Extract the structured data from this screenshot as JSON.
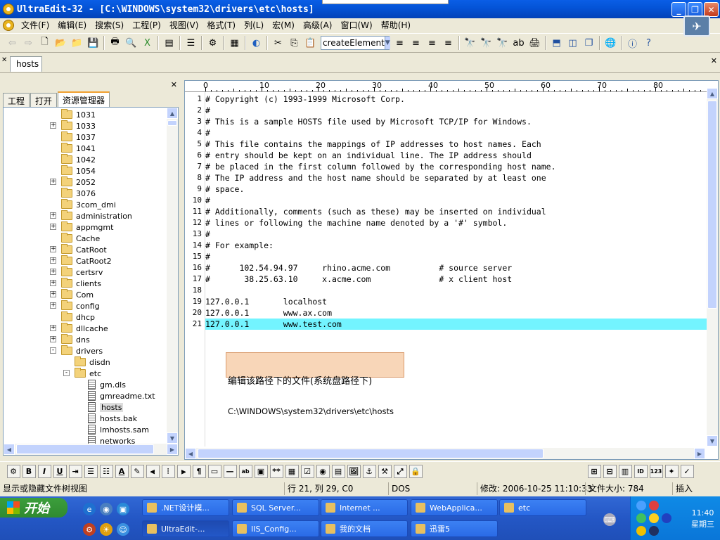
{
  "window": {
    "title": "UltraEdit-32 - [C:\\WINDOWS\\system32\\drivers\\etc\\hosts]"
  },
  "menu": [
    "文件(F)",
    "编辑(E)",
    "搜索(S)",
    "工程(P)",
    "视图(V)",
    "格式(T)",
    "列(L)",
    "宏(M)",
    "高级(A)",
    "窗口(W)",
    "帮助(H)"
  ],
  "toolbar": {
    "function_combo": "createElement"
  },
  "file_tab": {
    "label": "hosts"
  },
  "left_pane": {
    "tabs": [
      "工程",
      "打开",
      "资源管理器"
    ],
    "active_tab": "资源管理器",
    "tree": [
      {
        "label": "1031",
        "type": "folder",
        "expand": ""
      },
      {
        "label": "1033",
        "type": "folder",
        "expand": "+"
      },
      {
        "label": "1037",
        "type": "folder",
        "expand": ""
      },
      {
        "label": "1041",
        "type": "folder",
        "expand": ""
      },
      {
        "label": "1042",
        "type": "folder",
        "expand": ""
      },
      {
        "label": "1054",
        "type": "folder",
        "expand": ""
      },
      {
        "label": "2052",
        "type": "folder",
        "expand": "+"
      },
      {
        "label": "3076",
        "type": "folder",
        "expand": ""
      },
      {
        "label": "3com_dmi",
        "type": "folder",
        "expand": ""
      },
      {
        "label": "administration",
        "type": "folder",
        "expand": "+"
      },
      {
        "label": "appmgmt",
        "type": "folder",
        "expand": "+"
      },
      {
        "label": "Cache",
        "type": "folder",
        "expand": ""
      },
      {
        "label": "CatRoot",
        "type": "folder",
        "expand": "+"
      },
      {
        "label": "CatRoot2",
        "type": "folder",
        "expand": "+"
      },
      {
        "label": "certsrv",
        "type": "folder",
        "expand": "+"
      },
      {
        "label": "clients",
        "type": "folder",
        "expand": "+"
      },
      {
        "label": "Com",
        "type": "folder",
        "expand": "+"
      },
      {
        "label": "config",
        "type": "folder",
        "expand": "+"
      },
      {
        "label": "dhcp",
        "type": "folder",
        "expand": ""
      },
      {
        "label": "dllcache",
        "type": "folder",
        "expand": "+"
      },
      {
        "label": "dns",
        "type": "folder",
        "expand": "+"
      },
      {
        "label": "drivers",
        "type": "folder",
        "expand": "-"
      },
      {
        "label": "disdn",
        "type": "folder",
        "expand": "",
        "level": 1
      },
      {
        "label": "etc",
        "type": "folder",
        "expand": "-",
        "level": 1
      },
      {
        "label": "gm.dls",
        "type": "file",
        "level": 2
      },
      {
        "label": "gmreadme.txt",
        "type": "file",
        "level": 2
      },
      {
        "label": "hosts",
        "type": "file",
        "level": 2,
        "selected": true
      },
      {
        "label": "hosts.bak",
        "type": "file",
        "level": 2
      },
      {
        "label": "lmhosts.sam",
        "type": "file",
        "level": 2
      },
      {
        "label": "networks",
        "type": "file",
        "level": 2
      }
    ]
  },
  "ruler": {
    "labels": [
      "0",
      "10",
      "20",
      "30",
      "40",
      "50",
      "60",
      "70",
      "80"
    ]
  },
  "editor": {
    "lines": [
      "# Copyright (c) 1993-1999 Microsoft Corp.",
      "#",
      "# This is a sample HOSTS file used by Microsoft TCP/IP for Windows.",
      "#",
      "# This file contains the mappings of IP addresses to host names. Each",
      "# entry should be kept on an individual line. The IP address should",
      "# be placed in the first column followed by the corresponding host name.",
      "# The IP address and the host name should be separated by at least one",
      "# space.",
      "#",
      "# Additionally, comments (such as these) may be inserted on individual",
      "# lines or following the machine name denoted by a '#' symbol.",
      "#",
      "# For example:",
      "#",
      "#      102.54.94.97     rhino.acme.com          # source server",
      "#       38.25.63.10     x.acme.com              # x client host",
      "",
      "127.0.0.1       localhost",
      "127.0.0.1       www.ax.com",
      "127.0.0.1       www.test.com"
    ],
    "highlight_line": 21,
    "highlight_color": "#73f4ff"
  },
  "callout": {
    "line1": "编辑该路径下的文件(系统盘路径下)",
    "line2": "C:\\WINDOWS\\system32\\drivers\\etc\\hosts",
    "color": "#f8d6b8"
  },
  "status": {
    "hint": "显示或隐藏文件树视图",
    "position": "行 21, 列 29, C0",
    "format": "DOS",
    "modified": "修改: 2006-10-25 11:10:33",
    "filesize": "文件大小: 784",
    "mode": "插入"
  },
  "taskbar": {
    "start_label": "开始",
    "buttons_row1": [
      ".NET设计模...",
      "SQL Server...",
      "Internet ...",
      "WebApplica...",
      "etc"
    ],
    "buttons_row2": [
      "UltraEdit-...",
      "IIS_Config...",
      "我的文档",
      "迅雷5"
    ],
    "clock_time": "11:40",
    "clock_day": "星期三"
  },
  "colors": {
    "titlebar": "#0454d8",
    "taskbar": "#2457c5",
    "start": "#2f8a2f"
  }
}
